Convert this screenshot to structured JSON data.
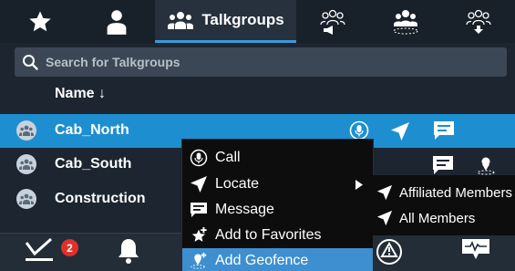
{
  "tabs": [
    {
      "icon": "star-icon",
      "label": ""
    },
    {
      "icon": "person-icon",
      "label": ""
    },
    {
      "icon": "group-icon",
      "label": "Talkgroups",
      "active": true
    },
    {
      "icon": "group-broadcast-icon",
      "label": ""
    },
    {
      "icon": "group-selected-icon",
      "label": ""
    },
    {
      "icon": "group-download-icon",
      "label": ""
    }
  ],
  "search": {
    "placeholder": "Search for Talkgroups",
    "value": ""
  },
  "list": {
    "column_header": "Name ↓",
    "rows": [
      {
        "label": "Cab_North",
        "selected": true
      },
      {
        "label": "Cab_South",
        "selected": false
      },
      {
        "label": "Construction",
        "selected": false
      }
    ]
  },
  "context_menu": {
    "items": [
      {
        "label": "Call",
        "icon": "call-icon"
      },
      {
        "label": "Locate",
        "icon": "locate-icon",
        "has_submenu": true
      },
      {
        "label": "Message",
        "icon": "message-icon"
      },
      {
        "label": "Add to Favorites",
        "icon": "add-favorite-icon"
      },
      {
        "label": "Add Geofence",
        "icon": "add-geofence-icon",
        "highlighted": true
      }
    ],
    "submenu": [
      {
        "label": "Affiliated Members",
        "icon": "locate-icon"
      },
      {
        "label": "All Members",
        "icon": "locate-icon"
      }
    ]
  },
  "bottom_bar": {
    "badge_count": "2"
  },
  "colors": {
    "accent": "#1d8fd0",
    "menu_highlight": "#3d8fcf",
    "badge": "#e0302a",
    "background": "#1c2530"
  }
}
